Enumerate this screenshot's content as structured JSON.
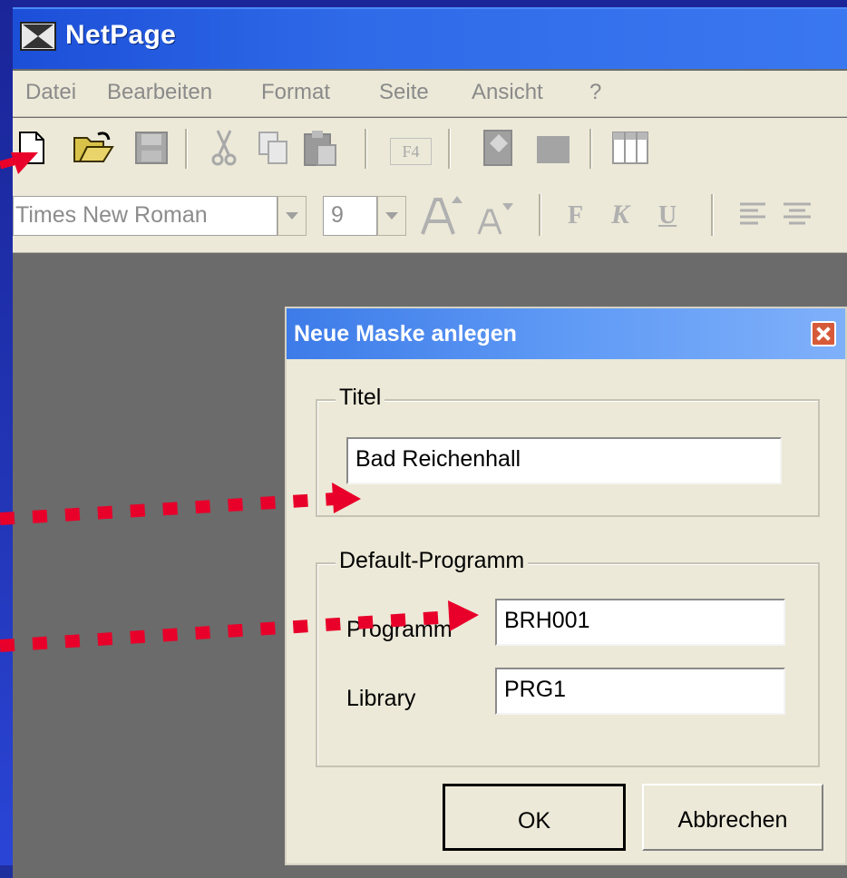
{
  "app": {
    "title": "NetPage"
  },
  "menu": {
    "items": [
      "Datei",
      "Bearbeiten",
      "Format",
      "Seite",
      "Ansicht",
      "?"
    ]
  },
  "formatbar": {
    "font": "Times New Roman",
    "size": "9",
    "bold_glyph": "F",
    "italic_glyph": "K",
    "underline_glyph": "U"
  },
  "toolbar": {
    "f4_label": "F4"
  },
  "dialog": {
    "title": "Neue Maske anlegen",
    "group_title": {
      "legend": "Titel",
      "value": "Bad Reichenhall"
    },
    "group_program": {
      "legend": "Default-Programm",
      "program_label": "Programm",
      "program_value": "BRH001",
      "library_label": "Library",
      "library_value": "PRG1"
    },
    "ok_label": "OK",
    "cancel_label": "Abbrechen"
  },
  "colors": {
    "arrow": "#e8002a",
    "titlebar": "#2f6ae8",
    "dialog_face": "#ece9d8"
  }
}
